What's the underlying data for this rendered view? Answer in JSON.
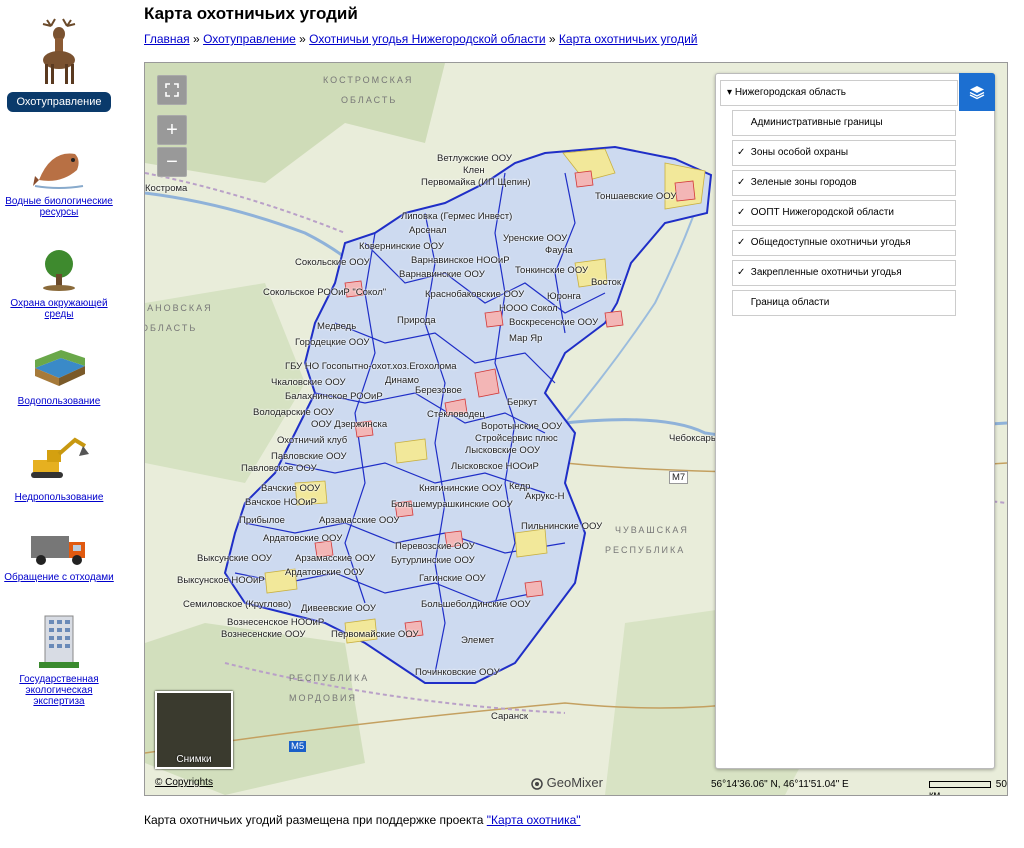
{
  "page": {
    "title": "Карта охотничьих угодий",
    "footer_text": "Карта охотничьих угодий размещена при поддержке проекта ",
    "footer_link": "\"Карта охотника\""
  },
  "breadcrumb": {
    "items": [
      "Главная",
      "Охотуправление",
      "Охотничьи угодья Нижегородской области",
      "Карта охотничьих угодий"
    ],
    "separator": "»"
  },
  "sidebar": {
    "active_label": "Охотуправление",
    "items": [
      {
        "label": "Водные биологические ресурсы",
        "icon": "fish-icon"
      },
      {
        "label": "Охрана окружающей среды",
        "icon": "tree-icon"
      },
      {
        "label": "Водопользование",
        "icon": "water-layers-icon"
      },
      {
        "label": "Недропользование",
        "icon": "excavator-icon"
      },
      {
        "label": "Обращение с отходами",
        "icon": "garbage-truck-icon"
      },
      {
        "label": "Государственная экологическая экспертиза",
        "icon": "building-icon"
      }
    ]
  },
  "map": {
    "layers_root": "Нижегородская область",
    "layers": [
      {
        "label": "Административные границы",
        "checked": false
      },
      {
        "label": "Зоны особой охраны",
        "checked": true
      },
      {
        "label": "Зеленые зоны городов",
        "checked": true
      },
      {
        "label": "ООПТ Нижегородской области",
        "checked": true
      },
      {
        "label": "Общедоступные охотничьи угодья",
        "checked": true
      },
      {
        "label": "Закрепленные охотничьи угодья",
        "checked": true
      },
      {
        "label": "Граница области",
        "checked": false
      }
    ],
    "snimki_label": "Снимки",
    "copyrights": "© Copyrights",
    "brand": "GeoMixer",
    "coords": "56°14'36.06\" N, 46°11'51.04\" E",
    "scale_label": "50 км",
    "region_labels": {
      "kostroma_1": "КОСТРОМСКАЯ",
      "kostroma_2": "ОБЛАСТЬ",
      "ivanovo_1": "ИВАНОВСКАЯ",
      "ivanovo_2": "ОБЛАСТЬ",
      "chuvash_1": "ЧУВАШСКАЯ",
      "chuvash_2": "РЕСПУБЛИКА",
      "mordovia_1": "РЕСПУБЛИКА",
      "mordovia_2": "МОРДОВИЯ"
    },
    "cities": {
      "kostroma": "Кострома",
      "cheboksary": "Чебоксары",
      "saransk": "Саранск"
    },
    "roads": {
      "m7": "М7",
      "m5": "М5"
    },
    "unit_labels": [
      "Ветлужские ООУ",
      "Клен",
      "Первомайка (ИП Щепин)",
      "Липовка (Гермес Инвест)",
      "Арсенал",
      "Тоншаевские ООУ",
      "Уренские ООУ",
      "Фауна",
      "Ковернинские ООУ",
      "Варнавинское НООиР",
      "Сокольские ООУ",
      "Варнавинские ООУ",
      "Тонкинские ООУ",
      "Восток",
      "Сокольское РООиР \"Сокол\"",
      "Краснобаковские ООУ",
      "Юронга",
      "НООО Сокол",
      "Медведь",
      "Природа",
      "Воскресенские ООУ",
      "Городецкие ООУ",
      "Мар Яр",
      "ГБУ НО Госопытно-охот.хоз.Егохолома",
      "Чкаловские ООУ",
      "Динамо",
      "Балахнинское РООиР",
      "Березовое",
      "Володарские ООУ",
      "Стекловодец",
      "Беркут",
      "ООУ Дзержинска",
      "Воротынские ООУ",
      "Охотничий клуб",
      "Стройсервис плюс",
      "Лысковские ООУ",
      "Павловские ООУ",
      "Лысковское НООиР",
      "Павловское ООУ",
      "Вачские ООУ",
      "Кедр",
      "Княгининские ООУ",
      "Вачское НООиР",
      "Акрукс-Н",
      "Большемурашкинские ООУ",
      "Прибылое",
      "Арзамасские ООУ",
      "Пильнинские ООУ",
      "Ардатовские ООУ",
      "Перевозские ООУ",
      "Выксунские ООУ",
      "Арзамасские ООУ",
      "Бутурлинские ООУ",
      "Ардатовские ООУ",
      "Выксунское НООиР",
      "Гагинские ООУ",
      "Семиловское (Круглово)",
      "Дивеевские ООУ",
      "Большеболдинские ООУ",
      "Вознесенское НООиР",
      "Вознесенские ООУ",
      "Первомайские ООУ",
      "Элемет",
      "Починковские ООУ"
    ]
  },
  "colors": {
    "link": "#0000cc",
    "active_nav": "#0a3a6b",
    "layers_button": "#1c6fd1",
    "region_fill": "#cddaf0",
    "region_border": "#1f2ec7",
    "protected_zone": "#e06060",
    "green_zone": "#f2e89a"
  }
}
